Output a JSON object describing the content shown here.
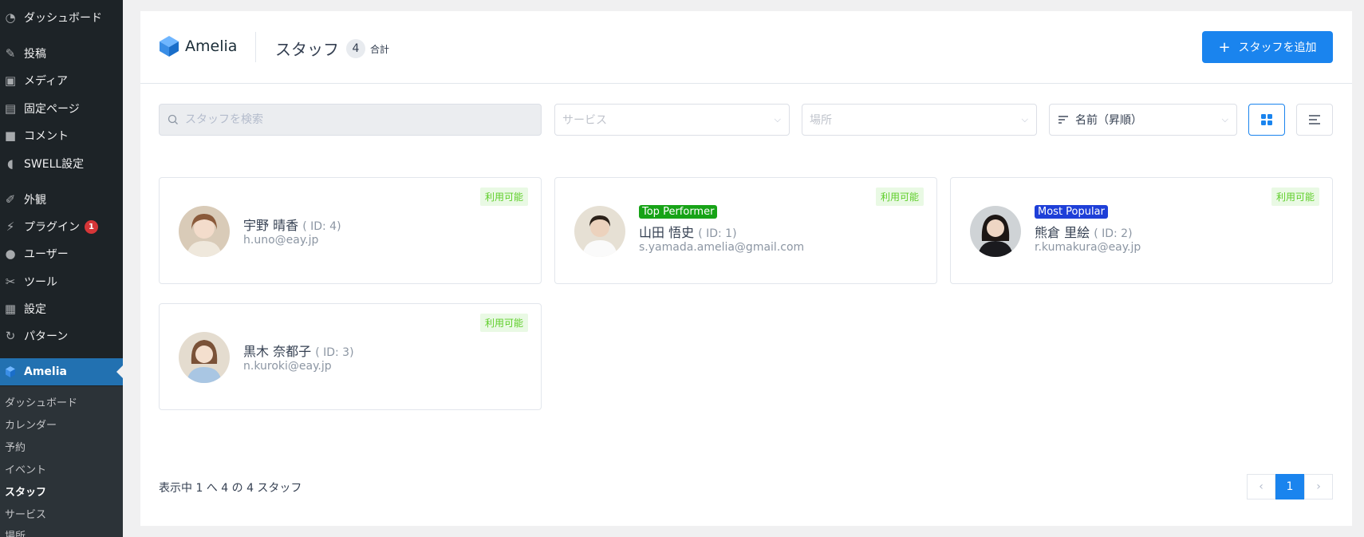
{
  "sidebar": {
    "items": [
      {
        "label": "ダッシュボード",
        "icon": "dashboard-icon"
      },
      {
        "label": "投稿",
        "icon": "pin-icon"
      },
      {
        "label": "メディア",
        "icon": "media-icon"
      },
      {
        "label": "固定ページ",
        "icon": "page-icon"
      },
      {
        "label": "コメント",
        "icon": "comment-icon"
      },
      {
        "label": "SWELL設定",
        "icon": "swell-icon"
      },
      {
        "label": "外観",
        "icon": "brush-icon"
      },
      {
        "label": "プラグイン",
        "icon": "plugin-icon",
        "badge": "1"
      },
      {
        "label": "ユーザー",
        "icon": "user-icon"
      },
      {
        "label": "ツール",
        "icon": "wrench-icon"
      },
      {
        "label": "設定",
        "icon": "settings-icon"
      },
      {
        "label": "パターン",
        "icon": "pattern-icon"
      },
      {
        "label": "Amelia",
        "icon": "amelia-icon"
      }
    ],
    "submenu": [
      "ダッシュボード",
      "カレンダー",
      "予約",
      "イベント",
      "スタッフ",
      "サービス",
      "場所"
    ]
  },
  "header": {
    "logo_text": "Amelia",
    "title": "スタッフ",
    "count": "4",
    "count_label": "合計",
    "add_button": "スタッフを追加"
  },
  "filters": {
    "search_placeholder": "スタッフを検索",
    "service_placeholder": "サービス",
    "location_placeholder": "場所",
    "sort_value": "名前（昇順）"
  },
  "employees": [
    {
      "name": "宇野 晴香",
      "id": "( ID: 4)",
      "email": "h.uno@eay.jp",
      "status": "利用可能",
      "tagline": ""
    },
    {
      "name": "山田 悟史",
      "id": "( ID: 1)",
      "email": "s.yamada.amelia@gmail.com",
      "status": "利用可能",
      "tagline": "Top Performer",
      "tag_color": "#17a317"
    },
    {
      "name": "熊倉 里絵",
      "id": "( ID: 2)",
      "email": "r.kumakura@eay.jp",
      "status": "利用可能",
      "tagline": "Most Popular",
      "tag_color": "#1e3fd8"
    },
    {
      "name": "黒木 奈都子",
      "id": "( ID: 3)",
      "email": "n.kuroki@eay.jp",
      "status": "利用可能",
      "tagline": ""
    }
  ],
  "footer": {
    "showing": "表示中 1 へ 4 の 4 スタッフ",
    "prev": "‹",
    "page": "1",
    "next": "›"
  },
  "colors": {
    "accent": "#1a84ee",
    "sidebar_bg": "#1d2327",
    "active_menu": "#2271b1",
    "available": "#5fce2a"
  }
}
